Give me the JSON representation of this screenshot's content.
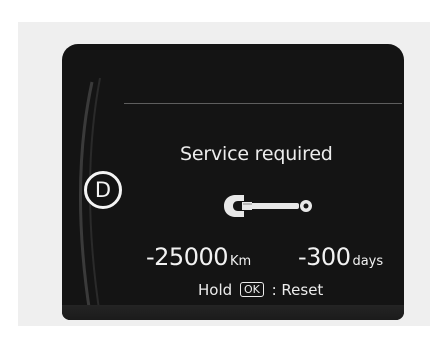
{
  "display": {
    "gear": "D",
    "title": "Service required",
    "distance": {
      "value": "-25000",
      "unit": "Km"
    },
    "days": {
      "value": "-300",
      "unit": "days"
    },
    "hold_label": "Hold",
    "ok_key": "OK",
    "reset_label": ": Reset",
    "icon": "wrench-icon"
  },
  "colors": {
    "screen_background": "#141414",
    "text": "#ececec",
    "frame": "#efefef"
  }
}
